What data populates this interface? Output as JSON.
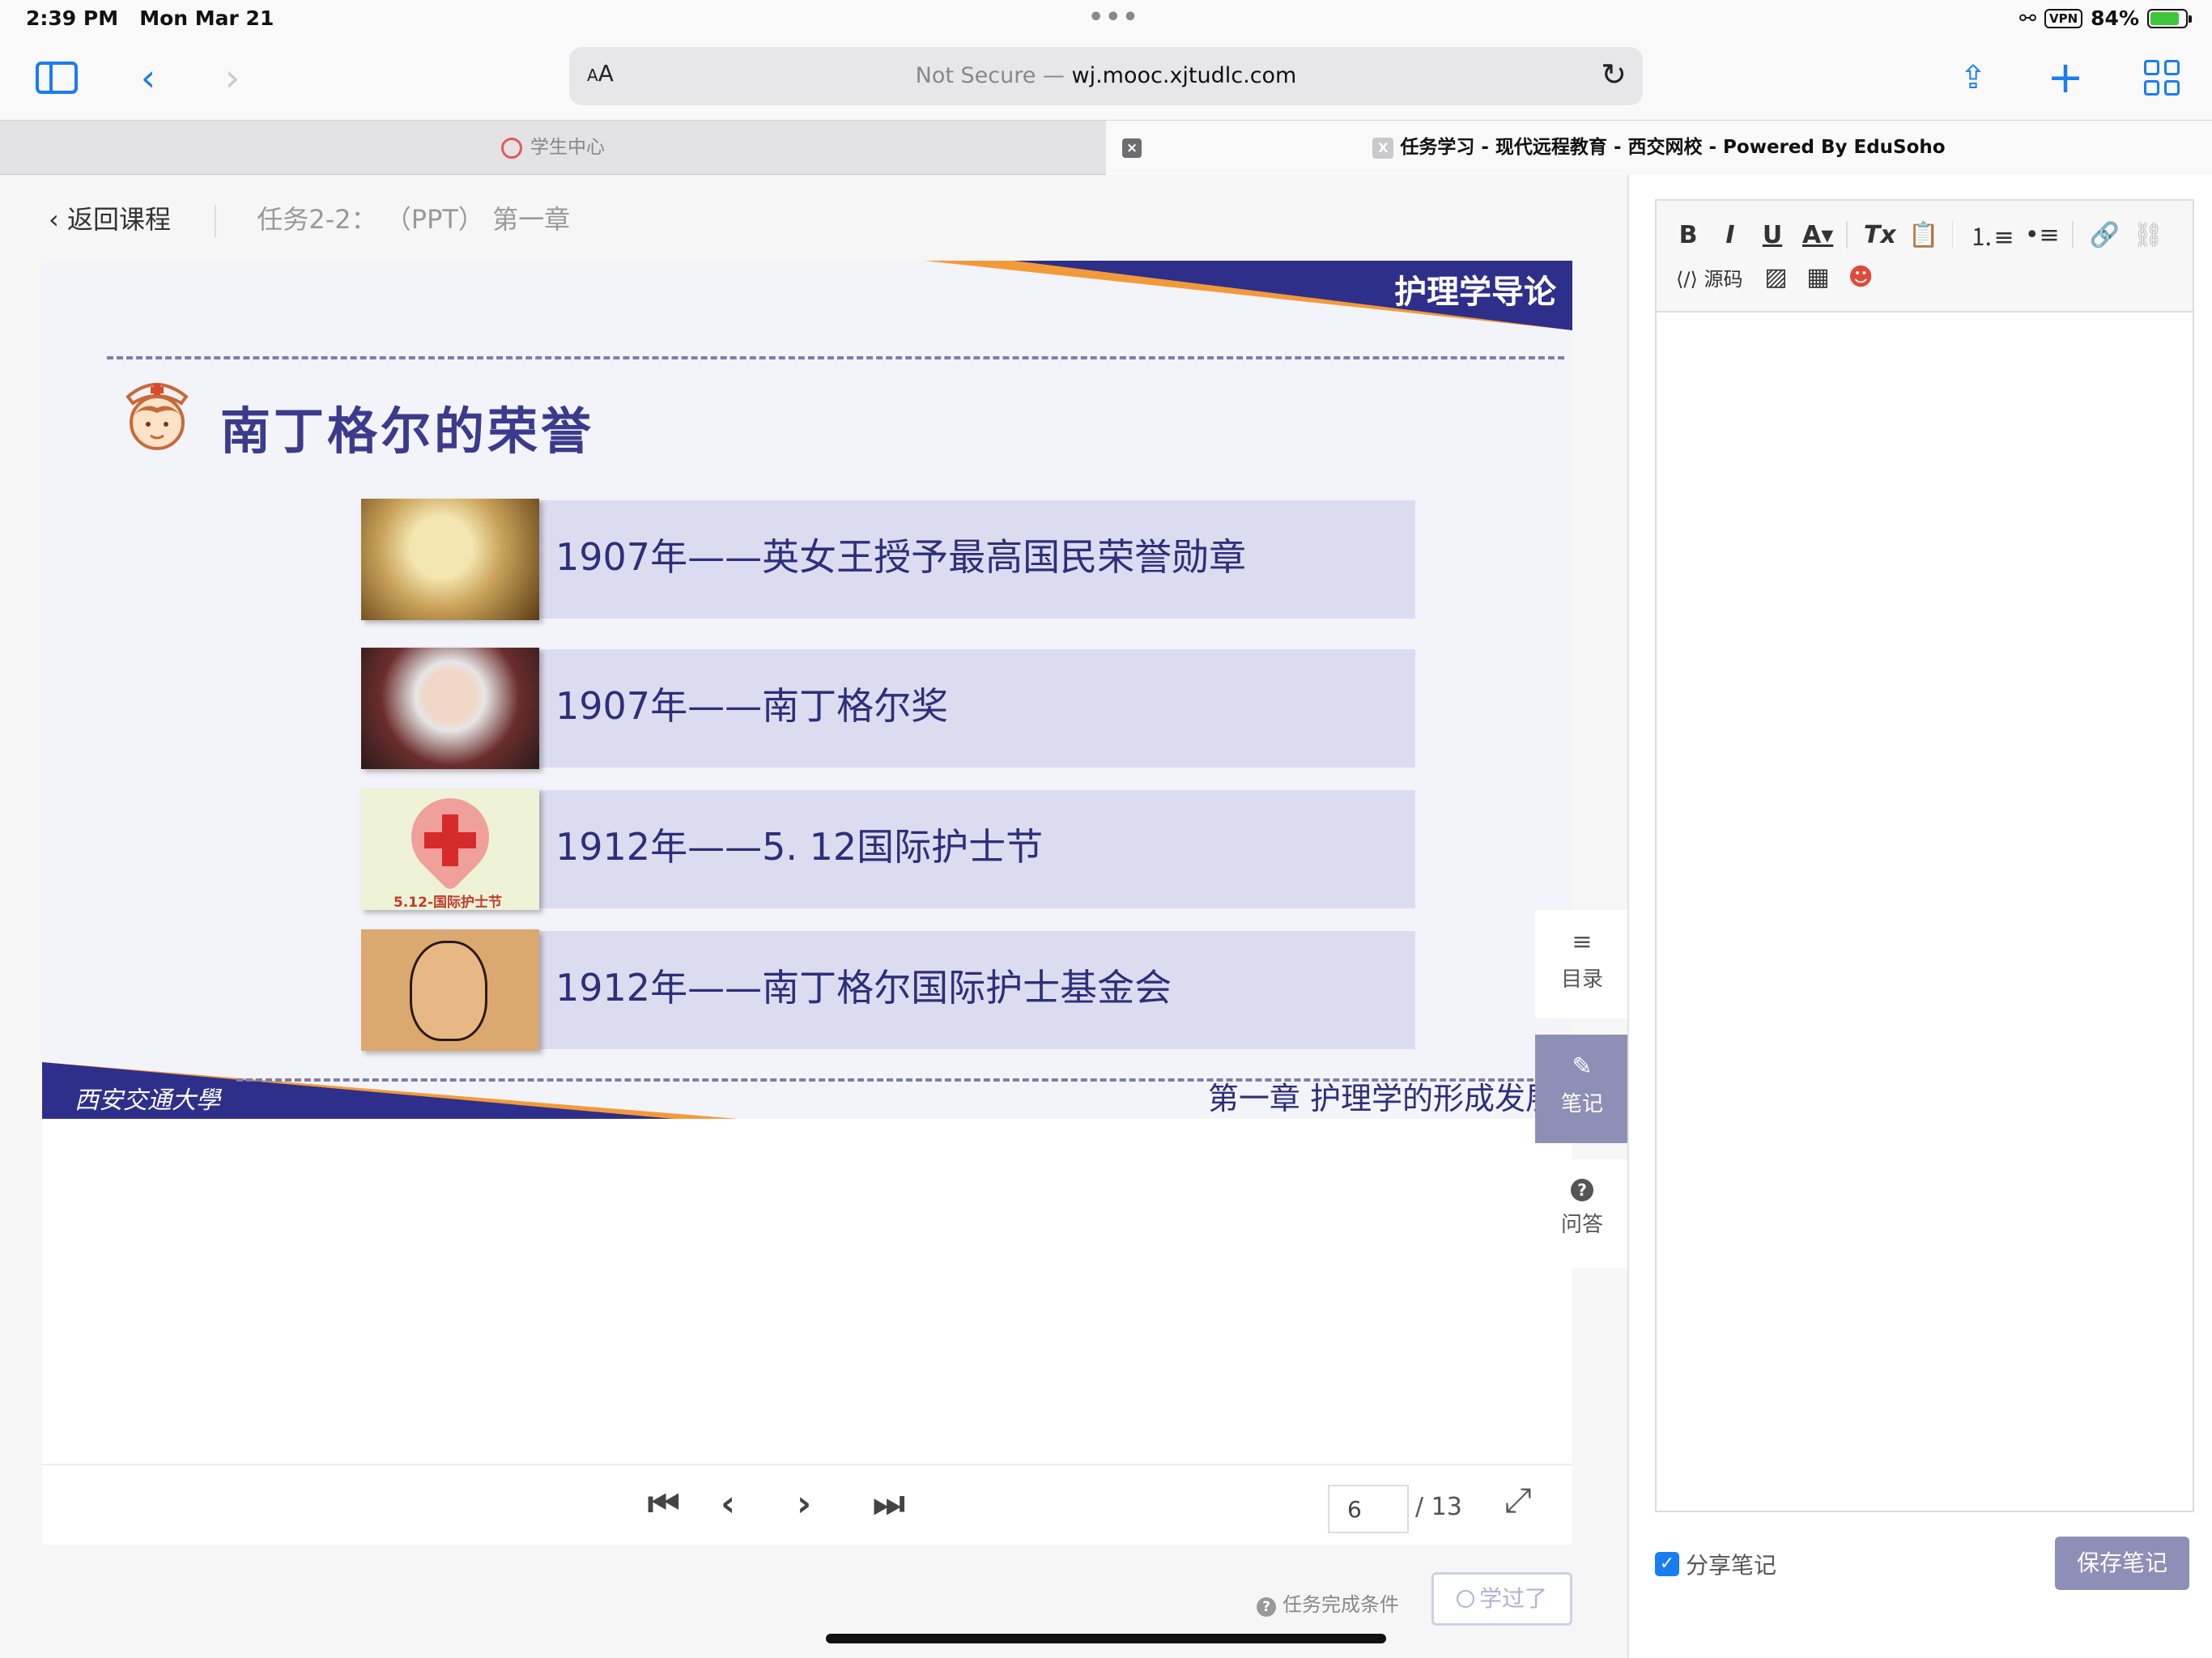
{
  "status": {
    "time": "2:39 PM",
    "date": "Mon Mar 21",
    "vpn": "VPN",
    "battery": "84%",
    "battery_level": 0.84
  },
  "browser": {
    "text_size_label": "AA",
    "not_secure": "Not Secure —",
    "domain": "wj.mooc.xjtudlc.com",
    "tabs": [
      {
        "label": "学生中心",
        "active": false
      },
      {
        "label": "任务学习 - 现代远程教育 - 西交网校 - Powered By EduSoho",
        "active": true
      }
    ]
  },
  "breadcrumb": {
    "back": "返回课程",
    "task_title": "任务2-2： （PPT） 第一章"
  },
  "slide": {
    "course": "护理学导论",
    "heading": "南丁格尔的荣誉",
    "items": [
      {
        "text": "1907年——英女王授予最高国民荣誉勋章"
      },
      {
        "text": "1907年——南丁格尔奖"
      },
      {
        "text": "1912年——5. 12国际护士节",
        "image_caption": "5.12-国际护士节"
      },
      {
        "text": "1912年——南丁格尔国际护士基金会"
      }
    ],
    "university": "西安交通大學",
    "chapter": "第一章  护理学的形成发展"
  },
  "pager": {
    "current_page": "6",
    "total": "/ 13"
  },
  "side_tools": [
    {
      "label": "目录",
      "icon": "list-icon",
      "active": false
    },
    {
      "label": "笔记",
      "icon": "pencil-icon",
      "active": true
    },
    {
      "label": "问答",
      "icon": "question-icon",
      "active": false
    }
  ],
  "footer": {
    "condition": "任务完成条件",
    "learned": "学过了"
  },
  "notes": {
    "source_label": "源码",
    "share_label": "分享笔记",
    "share_checked": true,
    "save_label": "保存笔记"
  },
  "colors": {
    "accent": "#8e8fb7",
    "slide_blue": "#2d2f8a",
    "slide_orange": "#f29a3a",
    "ios_blue": "#1a7cf3"
  }
}
